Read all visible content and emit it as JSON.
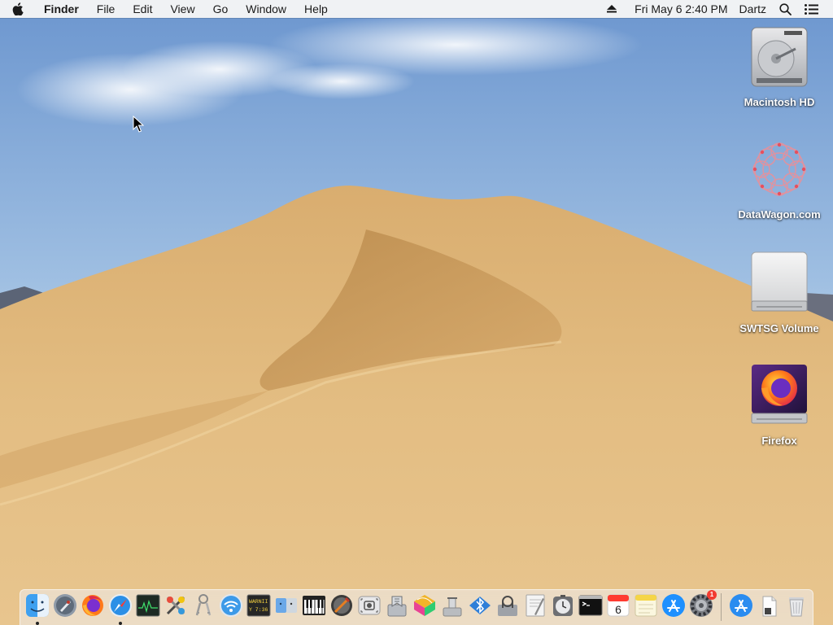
{
  "menubar": {
    "apple_icon": "apple-logo-icon",
    "app_name": "Finder",
    "items": [
      "File",
      "Edit",
      "View",
      "Go",
      "Window",
      "Help"
    ],
    "eject_icon": "eject-icon",
    "clock": "Fri May 6  2:40 PM",
    "user": "Dartz",
    "search_icon": "spotlight-search-icon",
    "notifications_icon": "notification-center-icon"
  },
  "desktop": {
    "icons": [
      {
        "label": "Macintosh HD",
        "icon": "internal-hard-drive-icon"
      },
      {
        "label": "DataWagon.com",
        "icon": "datawagon-logo-icon"
      },
      {
        "label": "SWTSG Volume",
        "icon": "external-drive-icon"
      },
      {
        "label": "Firefox",
        "icon": "firefox-disk-image-icon"
      }
    ]
  },
  "dock": {
    "apps": [
      {
        "name": "Finder",
        "icon": "finder-icon",
        "running": true
      },
      {
        "name": "Launchpad",
        "icon": "launchpad-icon",
        "running": false
      },
      {
        "name": "Firefox",
        "icon": "firefox-icon",
        "running": false
      },
      {
        "name": "Safari",
        "icon": "safari-icon",
        "running": true
      },
      {
        "name": "Activity Monitor",
        "icon": "activity-monitor-icon",
        "running": false
      },
      {
        "name": "ColorSync Utility",
        "icon": "colorsync-utility-icon",
        "running": false
      },
      {
        "name": "Keychain Access",
        "icon": "keychain-access-icon",
        "running": false
      },
      {
        "name": "Wireless Diagnostics",
        "icon": "wireless-diagnostics-icon",
        "running": false
      },
      {
        "name": "Console",
        "icon": "console-icon",
        "running": false,
        "text": [
          "WARNII",
          "Y 7:36"
        ]
      },
      {
        "name": "Migration Assistant",
        "icon": "migration-assistant-icon",
        "running": false
      },
      {
        "name": "Audio MIDI Setup",
        "icon": "audio-midi-setup-icon",
        "running": false
      },
      {
        "name": "Directory Utility",
        "icon": "directory-utility-icon",
        "running": false
      },
      {
        "name": "Screenshot",
        "icon": "screenshot-icon",
        "running": false
      },
      {
        "name": "Disk Utility",
        "icon": "disk-utility-icon",
        "running": false
      },
      {
        "name": "Grapher",
        "icon": "grapher-icon",
        "running": false
      },
      {
        "name": "Boot Camp Assistant",
        "icon": "boot-camp-assistant-icon",
        "running": false
      },
      {
        "name": "Bluetooth File Exchange",
        "icon": "bluetooth-file-exchange-icon",
        "running": false
      },
      {
        "name": "System Information",
        "icon": "system-information-icon",
        "running": false
      },
      {
        "name": "Script Editor",
        "icon": "script-editor-icon",
        "running": false
      },
      {
        "name": "Time Machine",
        "icon": "time-machine-icon",
        "running": false
      },
      {
        "name": "Terminal",
        "icon": "terminal-icon",
        "running": false
      },
      {
        "name": "Calendar",
        "icon": "calendar-icon",
        "running": false,
        "day": "6"
      },
      {
        "name": "Notes",
        "icon": "notes-icon",
        "running": false
      },
      {
        "name": "App Store",
        "icon": "app-store-icon",
        "running": false
      },
      {
        "name": "System Preferences",
        "icon": "system-preferences-icon",
        "running": false,
        "badge": "1"
      }
    ],
    "stacks": [
      {
        "name": "Applications",
        "icon": "applications-folder-icon"
      },
      {
        "name": "Documents",
        "icon": "documents-stack-icon"
      },
      {
        "name": "Trash",
        "icon": "trash-icon"
      }
    ]
  },
  "colors": {
    "sky_top": "#6f98cf",
    "sky_bottom": "#c8dcec",
    "dune_light": "#e1bb7f",
    "dune_shadow": "#b88b4c"
  }
}
